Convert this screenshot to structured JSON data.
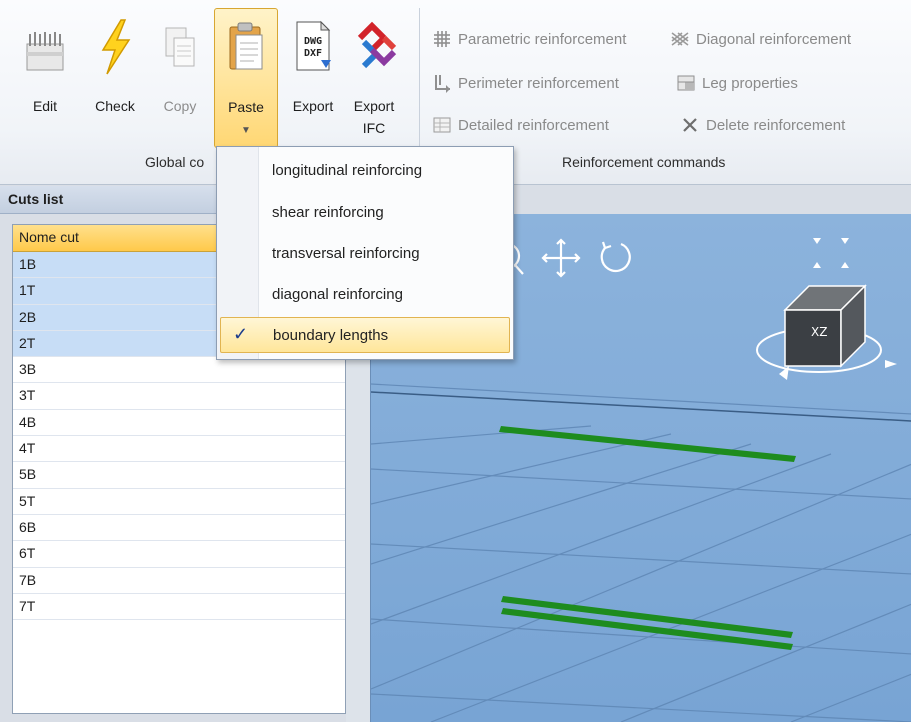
{
  "ribbon": {
    "buttons": {
      "edit": "Edit",
      "check": "Check",
      "copy": "Copy",
      "paste": "Paste",
      "export": "Export",
      "export_ifc_line1": "Export",
      "export_ifc_line2": "IFC"
    },
    "dwg_icon_text_1": "DWG",
    "dwg_icon_text_2": "DXF",
    "global_group_label": "Global co",
    "reinforcement_group_label": "Reinforcement commands",
    "reinforcement_commands": {
      "parametric": "Parametric reinforcement",
      "diagonal": "Diagonal reinforcement",
      "perimeter": "Perimeter reinforcement",
      "leg_properties": "Leg properties",
      "detailed": "Detailed reinforcement",
      "delete": "Delete reinforcement"
    }
  },
  "paste_menu": {
    "items": [
      {
        "label": "longitudinal reinforcing",
        "checked": false
      },
      {
        "label": "shear reinforcing",
        "checked": false
      },
      {
        "label": "transversal reinforcing",
        "checked": false
      },
      {
        "label": "diagonal reinforcing",
        "checked": false
      },
      {
        "label": "boundary lengths",
        "checked": true
      }
    ],
    "check_glyph": "✓"
  },
  "cuts_panel": {
    "title": "Cuts list",
    "column_header": "Nome cut",
    "rows": [
      "1B",
      "1T",
      "2B",
      "2T",
      "3B",
      "3T",
      "4B",
      "4T",
      "5B",
      "5T",
      "6B",
      "6T",
      "7B",
      "7T"
    ],
    "selected": [
      "1B",
      "1T",
      "2B",
      "2T"
    ]
  },
  "viewport": {
    "cube_face_label": "XZ"
  },
  "colors": {
    "accent_active": "#ffd774",
    "selection": "#c7ddf6",
    "viewport_bg": "#80aad7",
    "rebar_green": "#1e8c1e"
  }
}
